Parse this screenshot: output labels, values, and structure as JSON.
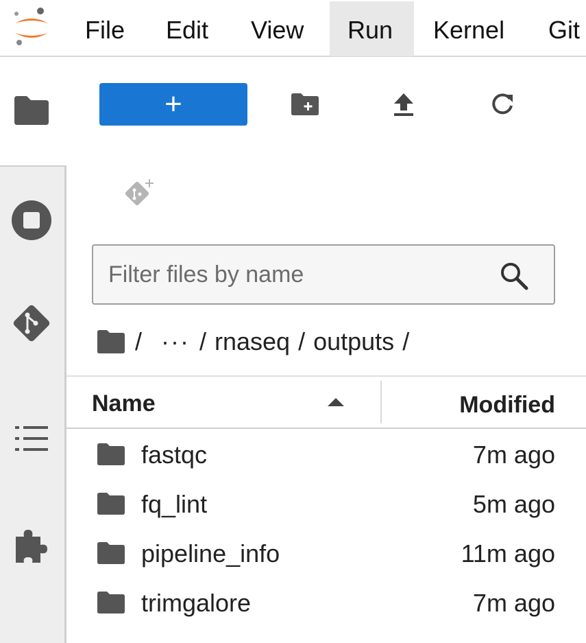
{
  "menu": {
    "items": [
      {
        "label": "File",
        "active": false
      },
      {
        "label": "Edit",
        "active": false
      },
      {
        "label": "View",
        "active": false
      },
      {
        "label": "Run",
        "active": true
      },
      {
        "label": "Kernel",
        "active": false
      },
      {
        "label": "Git",
        "active": false
      }
    ]
  },
  "sidebar": {
    "icons": [
      "folder-icon",
      "running-icon",
      "git-icon",
      "toc-icon",
      "extension-icon"
    ]
  },
  "toolbar": {
    "new_label": "+",
    "new_color": "#1976d2",
    "icons": [
      "new-folder-icon",
      "upload-icon",
      "refresh-icon"
    ]
  },
  "filter": {
    "placeholder": "Filter files by name",
    "value": ""
  },
  "breadcrumbs": {
    "root": "/",
    "ellipsis": "···",
    "path": [
      "rnaseq",
      "outputs"
    ],
    "sep": "/"
  },
  "list": {
    "headers": {
      "name": "Name",
      "modified": "Modified",
      "sort": "ascending"
    },
    "rows": [
      {
        "name": "fastqc",
        "modified": "7m ago"
      },
      {
        "name": "fq_lint",
        "modified": "5m ago"
      },
      {
        "name": "pipeline_info",
        "modified": "11m ago"
      },
      {
        "name": "trimgalore",
        "modified": "7m ago"
      }
    ]
  }
}
